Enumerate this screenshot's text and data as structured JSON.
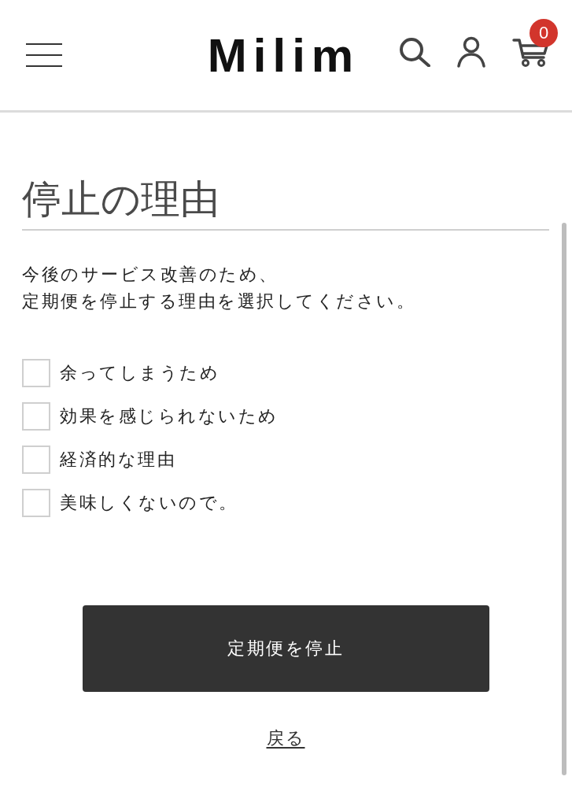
{
  "header": {
    "logo": "Milim",
    "cart_count": "0"
  },
  "title": "停止の理由",
  "description": [
    "今後のサービス改善のため、",
    "定期便を停止する理由を選択してください。"
  ],
  "reasons": [
    {
      "label": "余ってしまうため",
      "checked": false
    },
    {
      "label": "効果を感じられないため",
      "checked": false
    },
    {
      "label": "経済的な理由",
      "checked": false
    },
    {
      "label": "美味しくないので。",
      "checked": false
    }
  ],
  "submit_button": "定期便を停止",
  "back_link": "戻る"
}
